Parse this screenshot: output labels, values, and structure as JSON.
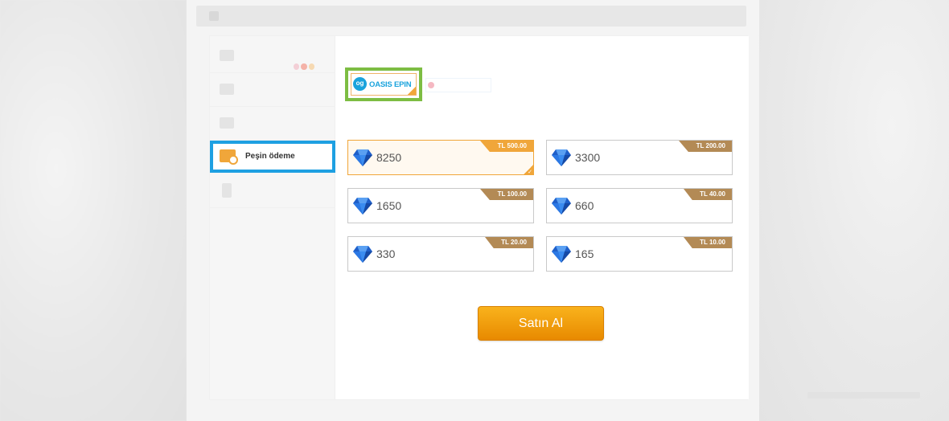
{
  "topbar": {
    "breadcrumb": ""
  },
  "sidebar": {
    "items": [
      {
        "label": "",
        "icon": "credit-card-icon"
      },
      {
        "label": "",
        "icon": "wallet-icon"
      },
      {
        "label": "",
        "icon": "mobile-payment-icon"
      },
      {
        "label": "Peşin ödeme",
        "icon": "cash-payment-icon",
        "active": true
      },
      {
        "label": "",
        "icon": "phone-icon"
      }
    ]
  },
  "providers": {
    "selected": {
      "logo_text": "og",
      "name": "OASIS EPIN"
    },
    "other": {
      "name": ""
    }
  },
  "packages": [
    {
      "amount": "8250",
      "price": "TL 500.00",
      "selected": true
    },
    {
      "amount": "3300",
      "price": "TL 200.00",
      "selected": false
    },
    {
      "amount": "1650",
      "price": "TL 100.00",
      "selected": false
    },
    {
      "amount": "660",
      "price": "TL 40.00",
      "selected": false
    },
    {
      "amount": "330",
      "price": "TL 20.00",
      "selected": false
    },
    {
      "amount": "165",
      "price": "TL 10.00",
      "selected": false
    }
  ],
  "actions": {
    "buy_label": "Satın Al"
  },
  "colors": {
    "accent": "#f0a63a",
    "highlight_blue": "#1ea0e2",
    "highlight_green": "#7dbd43",
    "price_tag": "#b38a55",
    "gem": "#2f6fd6"
  }
}
